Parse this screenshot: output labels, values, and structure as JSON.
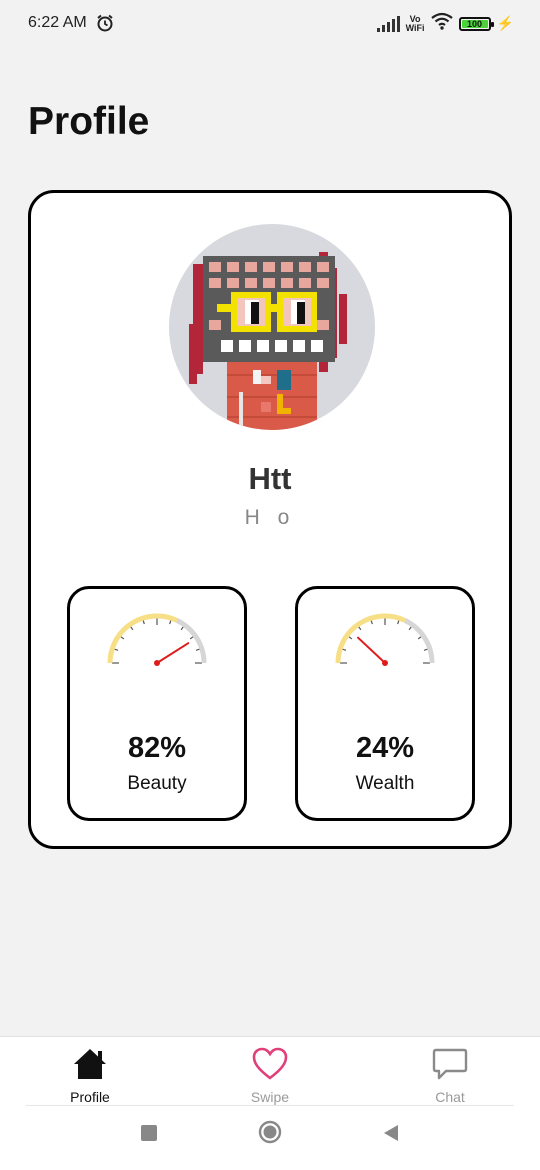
{
  "status_bar": {
    "time": "6:22 AM",
    "vowifi_top": "Vo",
    "vowifi_bottom": "WiFi",
    "battery": "100",
    "icons": [
      "alarm-icon",
      "signal-icon",
      "wifi-icon",
      "battery-icon",
      "charging-icon"
    ]
  },
  "page": {
    "title": "Profile"
  },
  "profile": {
    "name": "Htt",
    "subname": "H o"
  },
  "gauges": [
    {
      "percent_label": "82%",
      "label": "Beauty",
      "value": 0.82,
      "arc_color": "#f6df86"
    },
    {
      "percent_label": "24%",
      "label": "Wealth",
      "value": 0.24,
      "arc_color": "#f6df86"
    }
  ],
  "nav": {
    "items": [
      {
        "label": "Profile",
        "icon": "home-icon",
        "active": true
      },
      {
        "label": "Swipe",
        "icon": "heart-icon",
        "active": false
      },
      {
        "label": "Chat",
        "icon": "chat-bubble-icon",
        "active": false
      }
    ]
  },
  "system_nav": {
    "icons": [
      "recents-square-icon",
      "home-circle-icon",
      "back-triangle-icon"
    ]
  },
  "colors": {
    "background": "#f2f2f2",
    "card": "#ffffff",
    "needle": "#e01b1b",
    "heart": "#e0407a",
    "gauge_track": "#d6d6d6"
  }
}
